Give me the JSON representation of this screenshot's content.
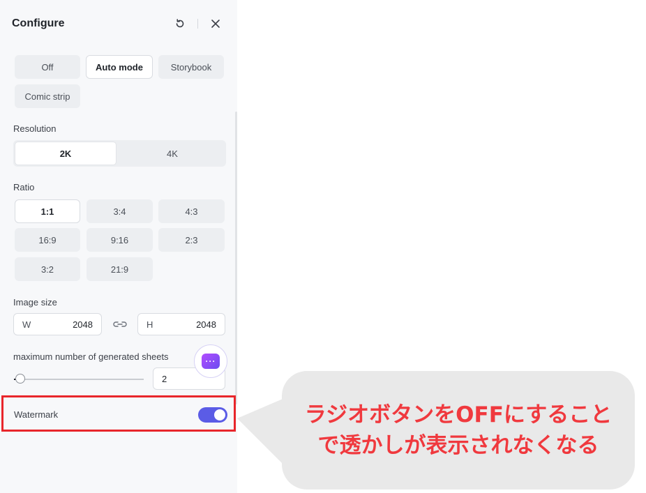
{
  "panel": {
    "title": "Configure",
    "modes": [
      "Off",
      "Auto mode",
      "Storybook",
      "Comic strip"
    ],
    "active_mode": "Auto mode",
    "resolution": {
      "label": "Resolution",
      "options": [
        "2K",
        "4K"
      ],
      "active": "2K"
    },
    "ratio": {
      "label": "Ratio",
      "options": [
        "1:1",
        "3:4",
        "4:3",
        "16:9",
        "9:16",
        "2:3",
        "3:2",
        "21:9"
      ],
      "active": "1:1"
    },
    "image_size": {
      "label": "Image size",
      "width_prefix": "W",
      "width_value": "2048",
      "height_prefix": "H",
      "height_value": "2048"
    },
    "sheets": {
      "label": "maximum number of generated sheets",
      "value": "2",
      "slider_fraction": 0.05
    },
    "watermark": {
      "label": "Watermark",
      "enabled": true
    },
    "chat_icon_text": "···"
  },
  "callout": {
    "line1": "ラジオボタンをOFFにすること",
    "line2": "で透かしが表示されなくなる"
  },
  "colors": {
    "accent": "#5b5ce6",
    "highlight": "#e8262b",
    "callout_text": "#f0393e"
  }
}
